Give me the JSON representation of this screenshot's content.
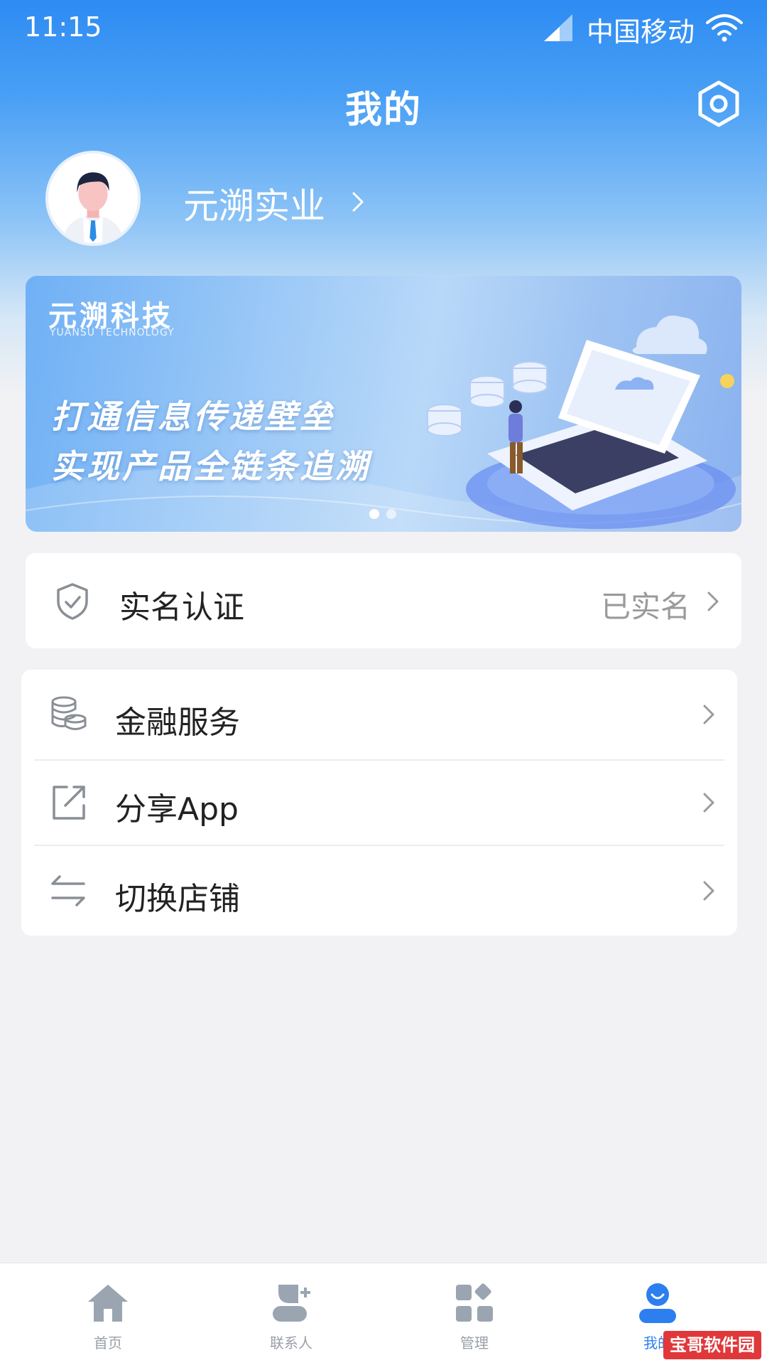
{
  "status_bar": {
    "time": "11:15",
    "carrier": "中国移动",
    "signal_icon": "cellular-signal-icon",
    "wifi_icon": "wifi-icon"
  },
  "header": {
    "title": "我的",
    "settings_icon": "gear-icon"
  },
  "profile": {
    "name": "元溯实业",
    "avatar_icon": "person-avatar",
    "chevron_icon": "chevron-right-icon"
  },
  "banner": {
    "brand": "元溯科技",
    "brand_en": "YUANSU TECHNOLOGY",
    "line1": "打通信息传递壁垒",
    "line2": "实现产品全链条追溯",
    "page_count": 2,
    "active_page": 1
  },
  "verification": {
    "label": "实名认证",
    "status": "已实名",
    "icon": "shield-check-icon"
  },
  "menu": {
    "items": [
      {
        "label": "金融服务",
        "icon": "coins-icon"
      },
      {
        "label": "分享App",
        "icon": "share-icon"
      },
      {
        "label": "切换店铺",
        "icon": "switch-arrows-icon"
      }
    ]
  },
  "tab_bar": {
    "tabs": [
      {
        "label": "首页",
        "icon": "home-icon",
        "active": false
      },
      {
        "label": "联系人",
        "icon": "add-contact-icon",
        "active": false
      },
      {
        "label": "管理",
        "icon": "grid-apps-icon",
        "active": false
      },
      {
        "label": "我的",
        "icon": "user-icon",
        "active": true
      }
    ]
  },
  "colors": {
    "primary": "#2d7ff0",
    "header_gradient_top": "#2d8bf2",
    "page_background": "#f2f2f4",
    "inactive_icon": "#9aa5b1",
    "watermark_red": "#e0383a"
  },
  "watermark": "宝哥软件园"
}
